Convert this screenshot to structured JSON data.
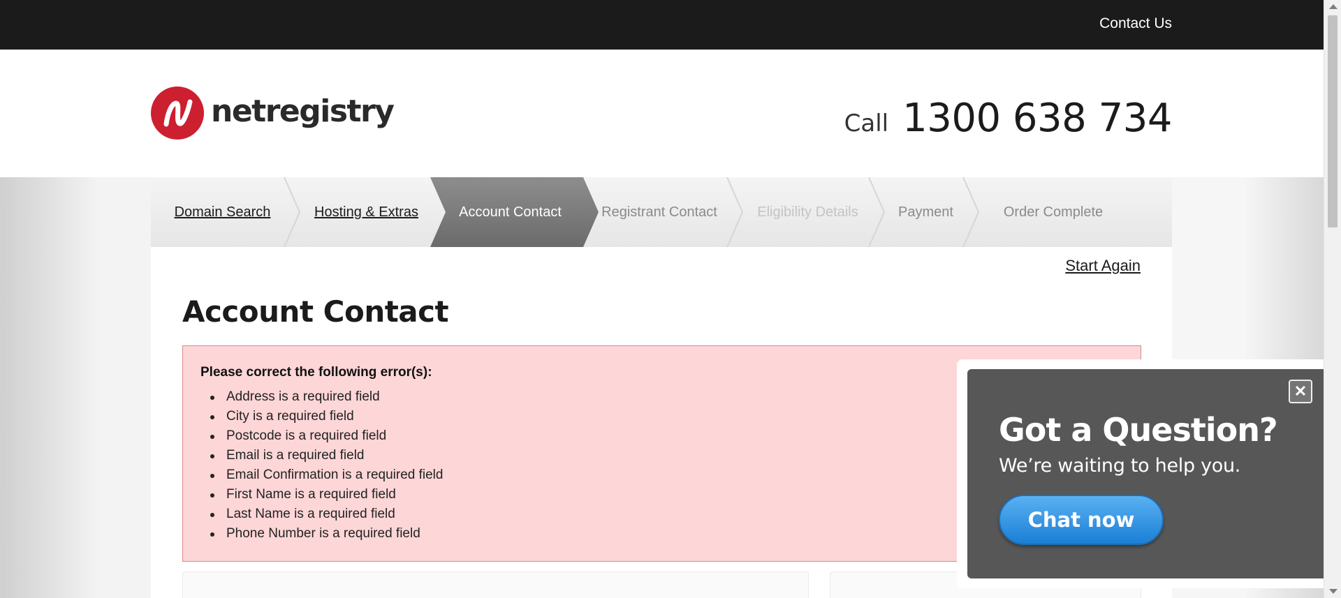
{
  "topbar": {
    "contact_label": "Contact Us"
  },
  "header": {
    "logo_text": "netregistry",
    "call_word": "Call",
    "phone_number": "1300 638 734"
  },
  "steps": [
    {
      "label": "Domain Search",
      "state": "link"
    },
    {
      "label": "Hosting & Extras",
      "state": "link"
    },
    {
      "label": "Account Contact",
      "state": "active"
    },
    {
      "label": "Registrant Contact",
      "state": "upcoming"
    },
    {
      "label": "Eligibility Details",
      "state": "disabled"
    },
    {
      "label": "Payment",
      "state": "upcoming"
    },
    {
      "label": "Order Complete",
      "state": "upcoming"
    }
  ],
  "start_again_label": "Start Again",
  "page_title": "Account Contact",
  "errors": {
    "heading": "Please correct the following error(s):",
    "items": [
      "Address is a required field",
      "City is a required field",
      "Postcode is a required field",
      "Email is a required field",
      "Email Confirmation is a required field",
      "First Name is a required field",
      "Last Name is a required field",
      "Phone Number is a required field"
    ]
  },
  "chat": {
    "close_label": "✕",
    "question": "Got a Question?",
    "subtitle": "We’re waiting to help you.",
    "button_label": "Chat now"
  },
  "colors": {
    "topbar": "#1b1b1b",
    "brand_red": "#cc1f2f",
    "error_bg": "#fdd6d7",
    "error_border": "#d9868a",
    "chat_bg": "#575757",
    "chat_button": "#2b8fe0"
  }
}
